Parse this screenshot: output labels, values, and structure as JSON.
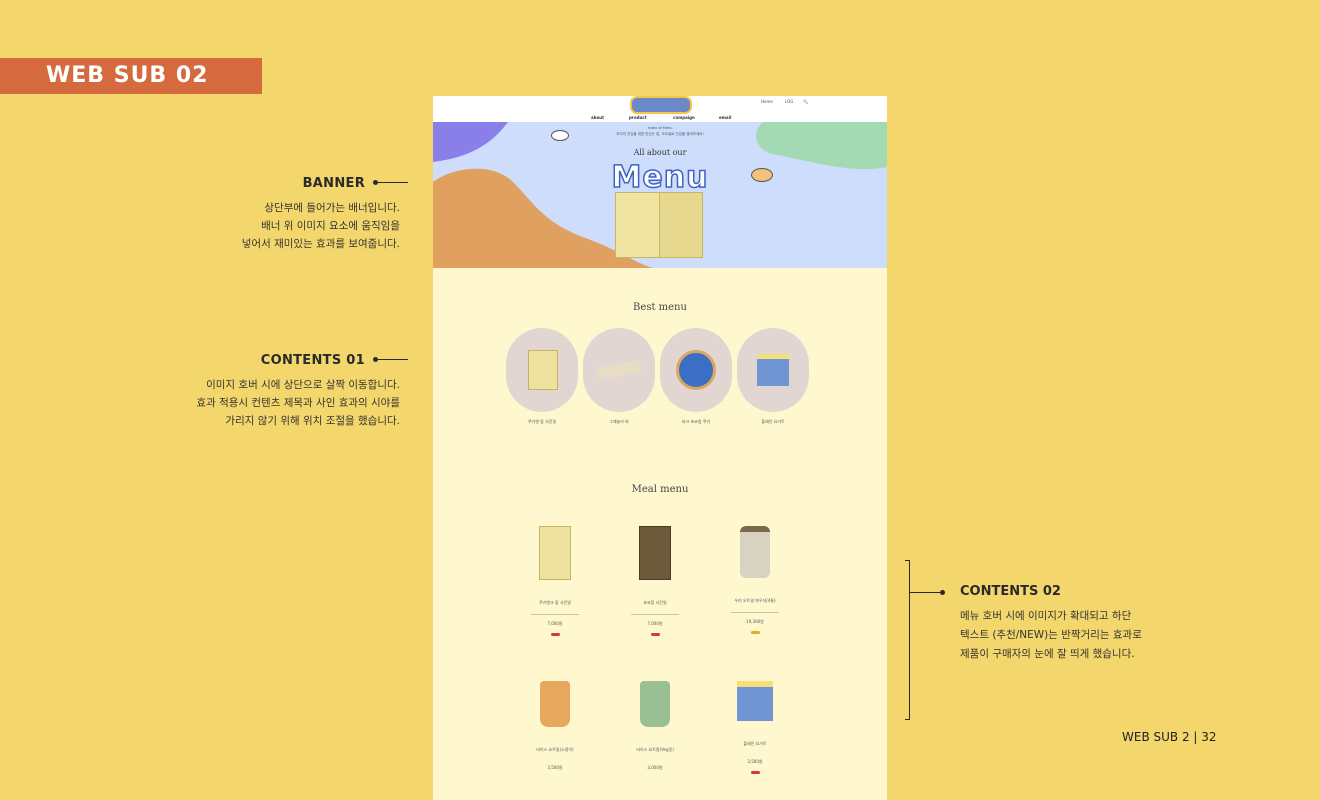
{
  "slide": {
    "title": "WEB SUB 02",
    "footer": "WEB SUB 2 |  32"
  },
  "annotations": {
    "banner": {
      "heading": "BANNER",
      "lines": [
        "상단부에 들어가는 배너입니다.",
        "배너 위 이미지 요소에 움직임을",
        "넣어서 재미있는 효과를 보여줍니다."
      ]
    },
    "contents01": {
      "heading": "CONTENTS 01",
      "lines": [
        "이미지 호버 시에 상단으로 살짝 이동합니다.",
        "효과 적용시 컨텐츠 제목과 사인 효과의 시야를",
        "가리지 않기 위해 위치 조절을 했습니다."
      ]
    },
    "contents02": {
      "heading": "CONTENTS 02",
      "lines": [
        "메뉴 호버 시에 이미지가 확대되고 하단",
        "텍스트 (추천/NEW)는 반짝거리는 효과로",
        "제품이 구매자의 눈에 잘 띄게 했습니다."
      ]
    }
  },
  "mockup": {
    "util": [
      "Home",
      "LOG",
      "🔍"
    ],
    "nav": [
      "about",
      "product",
      "campaign",
      "email"
    ],
    "tagline": [
      "Index of Menu",
      "우리의 건강을 위한 맛있는 밥, 오트밀로 건강을 챙겨보세요!"
    ],
    "banner": {
      "subtitle": "All about our",
      "title": "Menu"
    },
    "best_menu": {
      "title": "Best menu",
      "items": [
        "쿠키앤 팝 사진밀",
        "그래놀라 바",
        "바크 초코칩 쿠키",
        "플레인 요거트"
      ]
    },
    "meal_menu": {
      "title": "Meal menu",
      "items": [
        {
          "name": "쿠키앤크 팝 사진밀",
          "price": "7,000원",
          "badge_color": "#d33a3a"
        },
        {
          "name": "초코팝 사진밀",
          "price": "7,000원",
          "badge_color": "#d33a3a"
        },
        {
          "name": "우리 오트밀 파우더(4통)",
          "price": "19,300원",
          "badge_color": "#e0b21e"
        },
        {
          "name": "비어스 요트밀(소용이)",
          "price": "3,500원",
          "badge_color": ""
        },
        {
          "name": "비어스 요트밀(Veg맛)",
          "price": "3,000원",
          "badge_color": ""
        },
        {
          "name": "플레인 요거트",
          "price": "3,500원",
          "badge_color": "#d33a3a"
        }
      ]
    }
  }
}
